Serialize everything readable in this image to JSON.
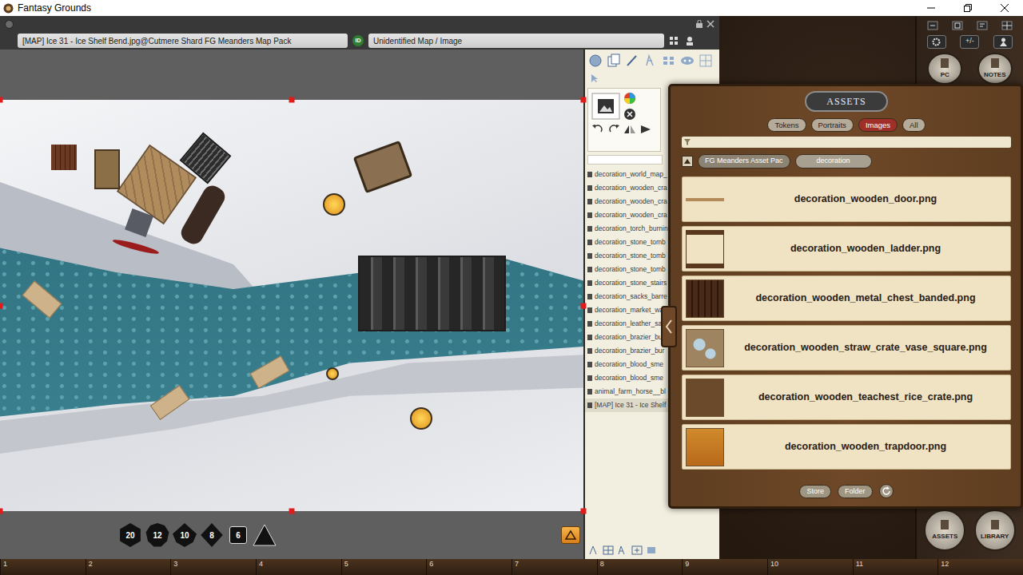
{
  "window": {
    "title": "Fantasy Grounds"
  },
  "image_window": {
    "title": "[MAP] Ice 31 - Ice Shelf Bend.jpg@Cutmere Shard FG Meanders Map Pack",
    "id_badge": "ID",
    "status": "Unidentified Map / Image"
  },
  "image_list": {
    "items": [
      {
        "label": "decoration_world_map_",
        "selected": false
      },
      {
        "label": "decoration_wooden_cra",
        "selected": false
      },
      {
        "label": "decoration_wooden_cra",
        "selected": false
      },
      {
        "label": "decoration_wooden_cra",
        "selected": false
      },
      {
        "label": "decoration_torch_burnin",
        "selected": false
      },
      {
        "label": "decoration_stone_tomb",
        "selected": false
      },
      {
        "label": "decoration_stone_tomb",
        "selected": false
      },
      {
        "label": "decoration_stone_tomb",
        "selected": false
      },
      {
        "label": "decoration_stone_stairs",
        "selected": false
      },
      {
        "label": "decoration_sacks_barre",
        "selected": false
      },
      {
        "label": "decoration_market_wa",
        "selected": false
      },
      {
        "label": "decoration_leather_sad",
        "selected": false
      },
      {
        "label": "decoration_brazier_bur",
        "selected": false
      },
      {
        "label": "decoration_brazier_bur",
        "selected": false
      },
      {
        "label": "decoration_blood_sme",
        "selected": false
      },
      {
        "label": "decoration_blood_sme",
        "selected": false
      },
      {
        "label": "animal_farm_horse__bl",
        "selected": false
      },
      {
        "label": "[MAP] Ice 31 - Ice Shelf",
        "selected": true
      }
    ]
  },
  "dice": [
    {
      "label": "20",
      "kind": "d20"
    },
    {
      "label": "12",
      "kind": "d12"
    },
    {
      "label": "10",
      "kind": "d10"
    },
    {
      "label": "8",
      "kind": "d8"
    },
    {
      "label": "6",
      "kind": "d6"
    }
  ],
  "assets": {
    "title": "ASSETS",
    "tabs": [
      {
        "label": "Tokens",
        "selected": false
      },
      {
        "label": "Portraits",
        "selected": false
      },
      {
        "label": "Images",
        "selected": true
      },
      {
        "label": "All",
        "selected": false
      }
    ],
    "path": [
      "FG Meanders Asset Pac",
      "decoration"
    ],
    "items": [
      "decoration_wooden_door.png",
      "decoration_wooden_ladder.png",
      "decoration_wooden_metal_chest_banded.png",
      "decoration_wooden_straw_crate_vase_square.png",
      "decoration_wooden_teachest_rice_crate.png",
      "decoration_wooden_trapdoor.png"
    ],
    "buttons": [
      "Store",
      "Folder"
    ]
  },
  "sidebar": {
    "modifier_label": "+/-",
    "top_buttons": [
      "PC",
      "NOTES"
    ],
    "bottom_buttons": [
      "ASSETS",
      "LIBRARY"
    ]
  },
  "hotkeys": [
    "1",
    "2",
    "3",
    "4",
    "5",
    "6",
    "7",
    "8",
    "9",
    "10",
    "11",
    "12"
  ]
}
